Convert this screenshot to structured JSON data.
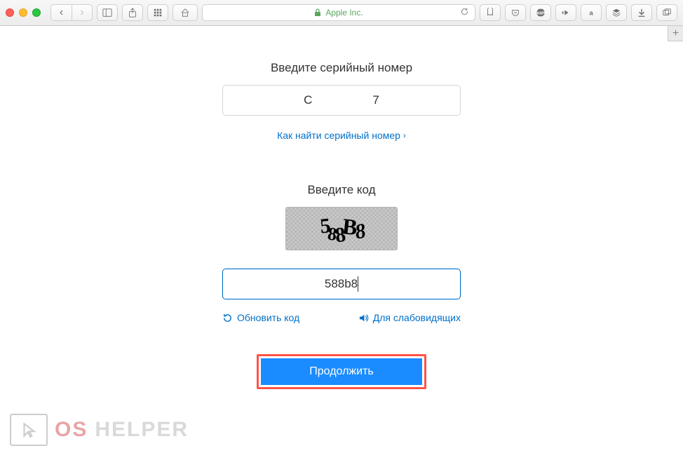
{
  "browser": {
    "domain": "Apple Inc."
  },
  "form": {
    "serial_label": "Введите серийный номер",
    "serial_value_left": "C",
    "serial_value_right": "7",
    "find_serial_link": "Как найти серийный номер",
    "captcha_label": "Введите код",
    "captcha_image_text": "588B8",
    "captcha_input_value": "588b8",
    "refresh_link": "Обновить код",
    "audio_link": "Для слабовидящих",
    "submit_label": "Продолжить"
  },
  "watermark": {
    "os": "OS",
    "helper": "HELPER"
  }
}
